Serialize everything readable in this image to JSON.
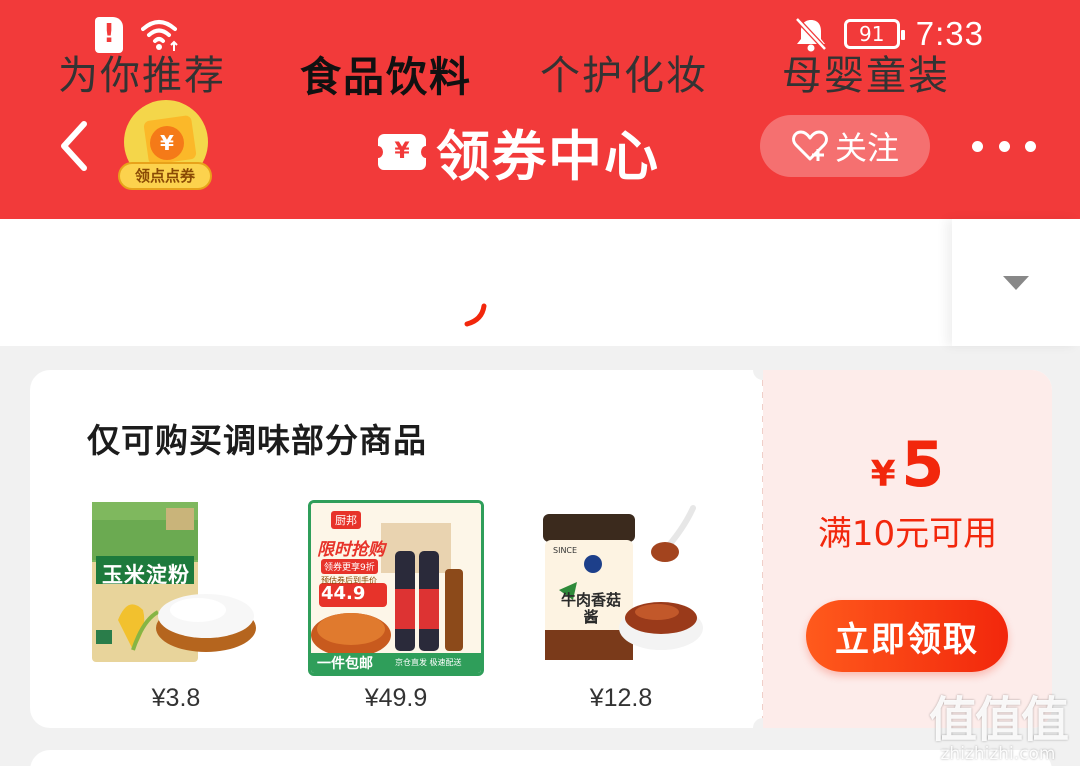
{
  "status_bar": {
    "battery": "91",
    "time": "7:33"
  },
  "header": {
    "title": "领券中心",
    "title_ticket_symbol": "¥",
    "badge_coin": "¥",
    "badge_label": "领点点券",
    "follow_label": "关注"
  },
  "tabs": [
    {
      "label": "为你推荐",
      "active": false
    },
    {
      "label": "食品饮料",
      "active": true
    },
    {
      "label": "个护化妆",
      "active": false
    },
    {
      "label": "母婴童装",
      "active": false
    }
  ],
  "coupon": {
    "title": "仅可购买调味部分商品",
    "products": [
      {
        "name": "玉米淀粉",
        "price": "¥3.8"
      },
      {
        "name": "厨邦",
        "promo": "限时抢购",
        "sub_promo": "领券更享9折",
        "pre_price": "预估券后到手价",
        "promo_price": "44.9",
        "banner": "一件包邮",
        "banner2": "京仓直发 极速配送",
        "price": "¥49.9"
      },
      {
        "name": "牛肉香菇酱",
        "since": "SINCE",
        "price": "¥12.8"
      }
    ],
    "currency": "¥",
    "amount": "5",
    "condition": "满10元可用",
    "claim_label": "立即领取"
  },
  "watermark": {
    "text": "值值值",
    "domain": "zhizhizhi.com"
  },
  "colors": {
    "brand_red": "#f23a3a",
    "coupon_red": "#f2270c",
    "coupon_bg": "#fdecea"
  }
}
